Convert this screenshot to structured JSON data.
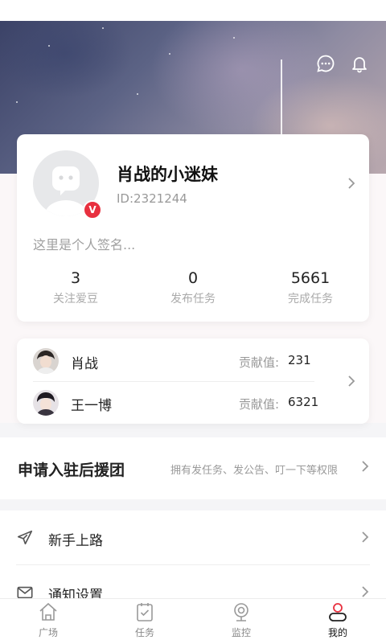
{
  "profile": {
    "name": "肖战的小迷妹",
    "id_text": "ID:2321244",
    "signature_placeholder": "这里是个人签名...",
    "badge": "V",
    "stats": [
      {
        "value": "3",
        "label": "关注爱豆"
      },
      {
        "value": "0",
        "label": "发布任务"
      },
      {
        "value": "5661",
        "label": "完成任务"
      }
    ]
  },
  "idols": [
    {
      "name": "肖战",
      "contrib_label": "贡献值:",
      "contrib_value": "231"
    },
    {
      "name": "王一博",
      "contrib_label": "贡献值:",
      "contrib_value": "6321"
    }
  ],
  "apply": {
    "title": "申请入驻后援团",
    "desc": "拥有发任务、发公告、叮一下等权限"
  },
  "menu": [
    {
      "label": "新手上路",
      "icon": "paper-plane-icon"
    },
    {
      "label": "通知设置",
      "icon": "mail-icon"
    }
  ],
  "tabs": [
    {
      "label": "广场",
      "icon": "home-icon",
      "active": false
    },
    {
      "label": "任务",
      "icon": "task-icon",
      "active": false
    },
    {
      "label": "监控",
      "icon": "camera-icon",
      "active": false
    },
    {
      "label": "我的",
      "icon": "user-icon",
      "active": true
    }
  ],
  "colors": {
    "accent": "#e8303f",
    "badge": "#e8303f"
  }
}
